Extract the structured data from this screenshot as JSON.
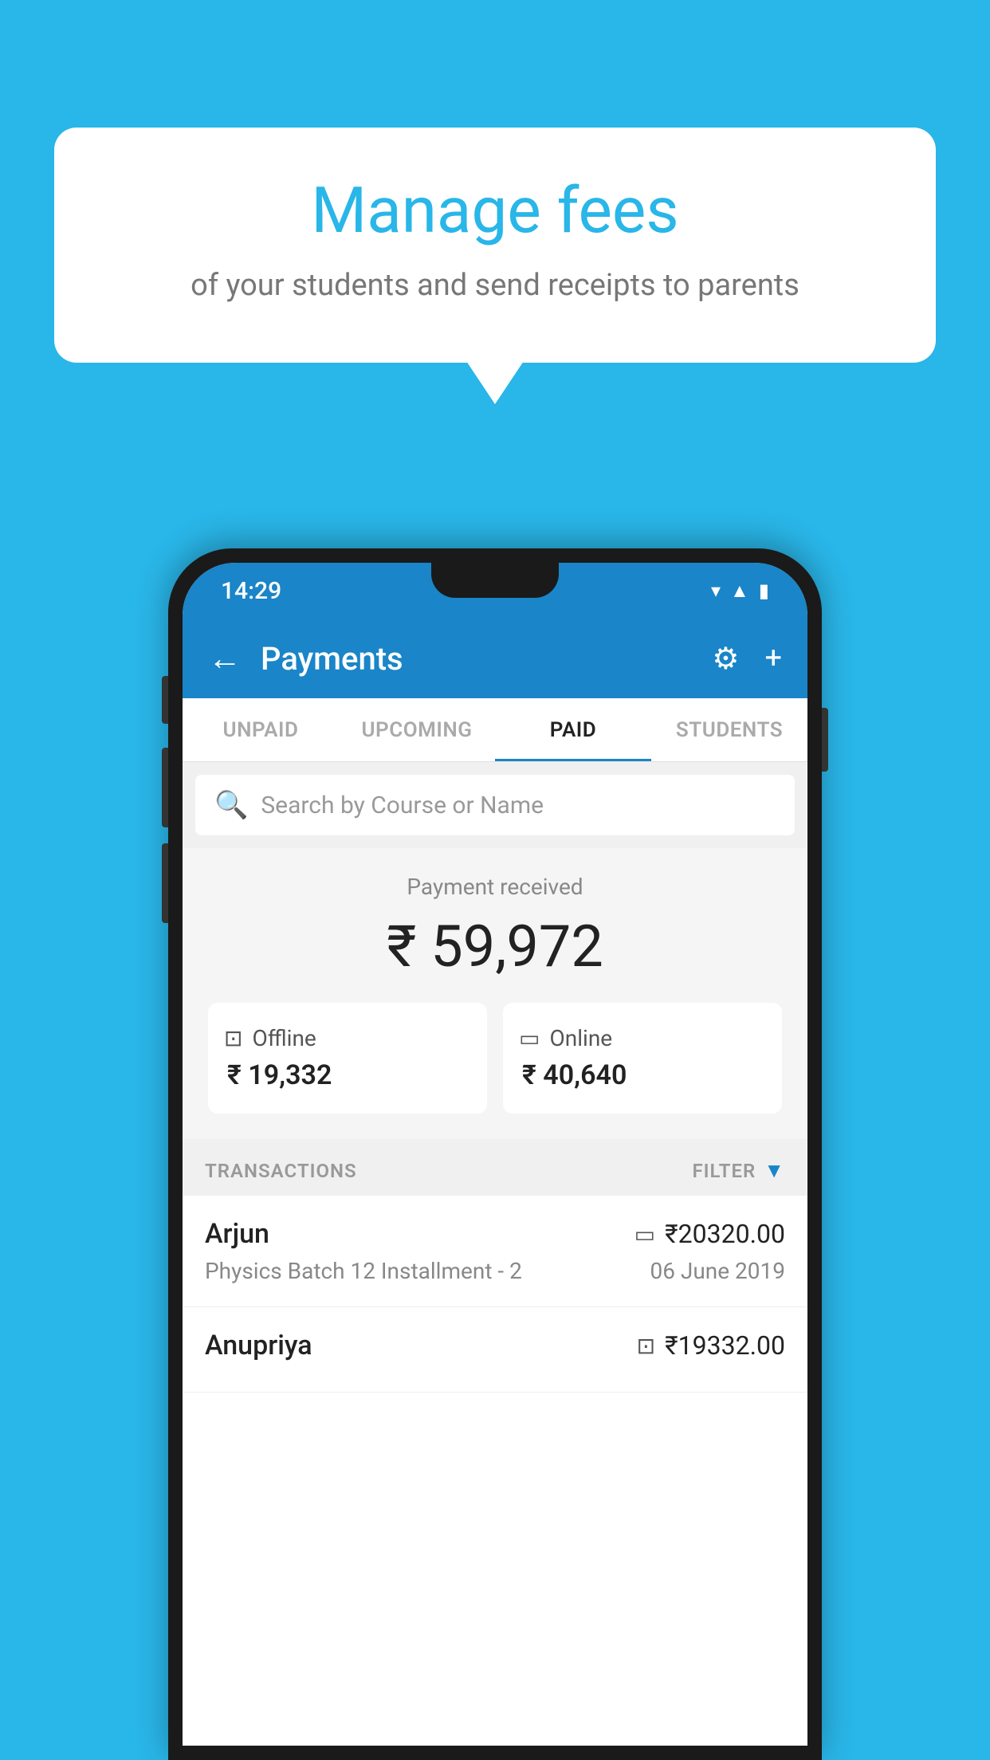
{
  "background_color": "#29b6e8",
  "bubble": {
    "title": "Manage fees",
    "subtitle": "of your students and send receipts to parents"
  },
  "status_bar": {
    "time": "14:29",
    "icons": [
      "wifi",
      "signal",
      "battery"
    ]
  },
  "app_bar": {
    "title": "Payments",
    "back_label": "←",
    "settings_label": "⚙",
    "add_label": "+"
  },
  "tabs": [
    {
      "label": "UNPAID",
      "active": false
    },
    {
      "label": "UPCOMING",
      "active": false
    },
    {
      "label": "PAID",
      "active": true
    },
    {
      "label": "STUDENTS",
      "active": false
    }
  ],
  "search": {
    "placeholder": "Search by Course or Name"
  },
  "payment_summary": {
    "label": "Payment received",
    "total": "₹ 59,972",
    "offline": {
      "label": "Offline",
      "amount": "₹ 19,332"
    },
    "online": {
      "label": "Online",
      "amount": "₹ 40,640"
    }
  },
  "transactions": {
    "header_label": "TRANSACTIONS",
    "filter_label": "FILTER",
    "items": [
      {
        "name": "Arjun",
        "amount": "₹20320.00",
        "course": "Physics Batch 12 Installment - 2",
        "date": "06 June 2019",
        "payment_type": "online"
      },
      {
        "name": "Anupriya",
        "amount": "₹19332.00",
        "course": "",
        "date": "",
        "payment_type": "offline"
      }
    ]
  }
}
